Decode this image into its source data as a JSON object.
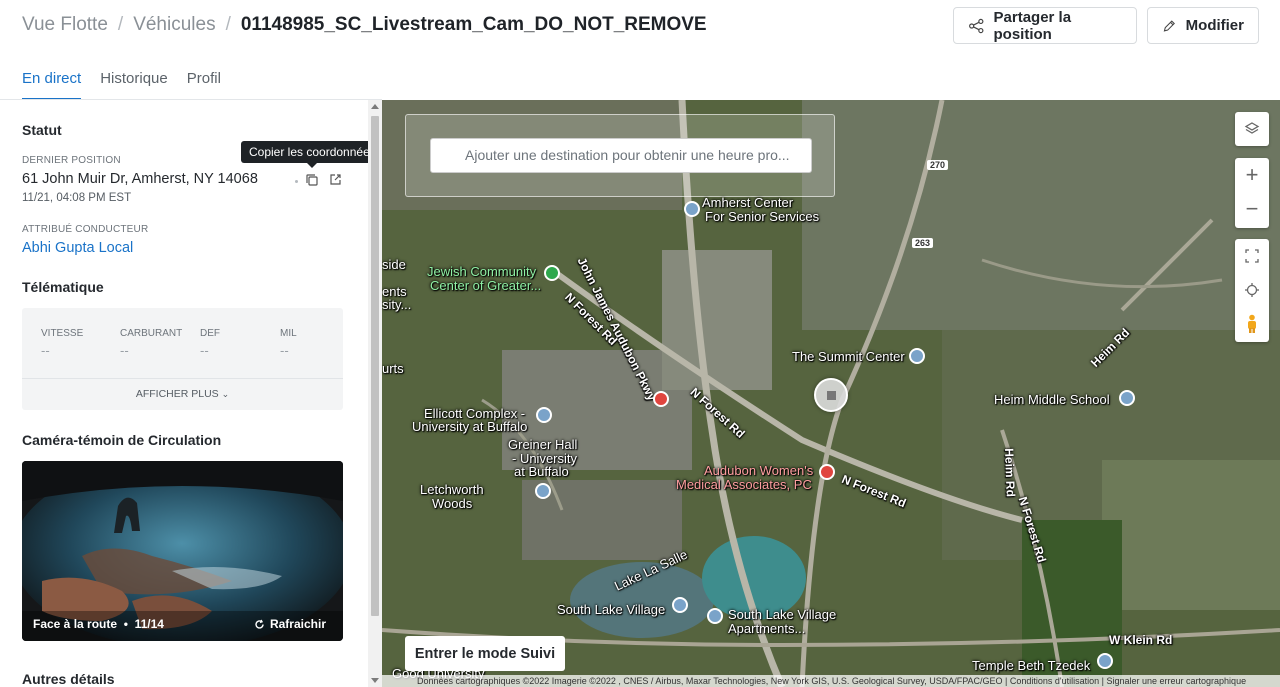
{
  "breadcrumb": {
    "root": "Vue Flotte",
    "section": "Véhicules",
    "current": "01148985_SC_Livestream_Cam_DO_NOT_REMOVE"
  },
  "header": {
    "share_label": "Partager la position",
    "edit_label": "Modifier"
  },
  "tabs": [
    {
      "label": "En direct",
      "active": true
    },
    {
      "label": "Historique"
    },
    {
      "label": "Profil"
    }
  ],
  "status": {
    "title": "Statut",
    "last_position_label": "DERNIER POSITION",
    "address": "61 John Muir Dr, Amherst, NY 14068",
    "timestamp": "11/21, 04:08 PM EST",
    "copy_tooltip": "Copier les coordonnées",
    "driver_label": "ATTRIBUÉ CONDUCTEUR",
    "driver": "Abhi Gupta Local"
  },
  "telematics": {
    "title": "Télématique",
    "fields": [
      {
        "label": "VITESSE",
        "value": "--"
      },
      {
        "label": "CARBURANT",
        "value": "--"
      },
      {
        "label": "DEF",
        "value": "--"
      },
      {
        "label": "MIL",
        "value": "--"
      }
    ],
    "show_more": "AFFICHER PLUS"
  },
  "camera": {
    "title": "Caméra-témoin de Circulation",
    "view": "Face à la route",
    "date": "11/14",
    "refresh": "Rafraichir"
  },
  "other": {
    "title": "Autres détails"
  },
  "map": {
    "search_placeholder": "Ajouter une destination pour obtenir une heure pro...",
    "follow_label": "Entrer le mode Suivi",
    "attribution": "Données cartographiques ©2022 Imagerie ©2022 , CNES / Airbus, Maxar Technologies, New York GIS, U.S. Geological Survey, USDA/FPAC/GEO  |  Conditions d'utilisation  |  Signaler une erreur cartographique",
    "labels": {
      "amherst_center": "Amherst Center",
      "senior_services": "For Senior Services",
      "jcc_1": "Jewish Community",
      "jcc_2": "Center of Greater...",
      "john_james": "John James Audubon Pkwy",
      "n_forest_1": "N Forest Rd",
      "n_forest_2": "N Forest Rd",
      "n_forest_3": "N Forest Rd",
      "n_forest_4": "N Forest Rd",
      "summit": "The Summit Center",
      "heim_middle": "Heim Middle School",
      "heim_rd_1": "Heim Rd",
      "heim_rd_2": "Heim Rd",
      "ellicott_1": "Ellicott Complex -",
      "ellicott_2": "University at Buffalo",
      "greiner_1": "Greiner Hall",
      "greiner_2": "- University",
      "greiner_3": "at Buffalo",
      "audubon_women_1": "Audubon Women's",
      "audubon_women_2": "Medical Associates, PC",
      "letchworth_1": "Letchworth",
      "letchworth_2": "Woods",
      "lake_lasalle": "Lake La Salle",
      "slv": "South Lake Village",
      "slv_apt_1": "South Lake Village",
      "slv_apt_2": "Apartments...",
      "w_klein": "W Klein Rd",
      "temple": "Temple Beth Tzedek",
      "side_1": "side",
      "side_2": "ents",
      "side_3": "sity...",
      "urts": "urts",
      "good_univ": "Good University",
      "route_270": "270",
      "route_263": "263"
    }
  }
}
